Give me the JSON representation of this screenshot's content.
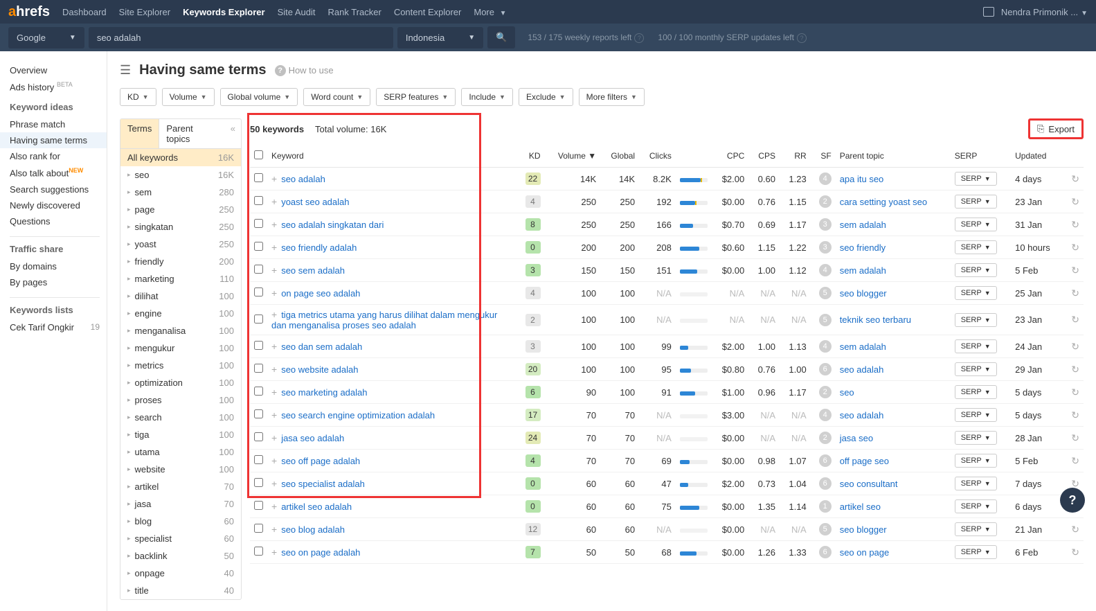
{
  "topnav": {
    "logo_a": "a",
    "logo_rest": "hrefs",
    "items": [
      "Dashboard",
      "Site Explorer",
      "Keywords Explorer",
      "Site Audit",
      "Rank Tracker",
      "Content Explorer",
      "More"
    ],
    "active_index": 2,
    "user": "Nendra Primonik ..."
  },
  "subbar": {
    "engine": "Google",
    "query": "seo adalah",
    "country": "Indonesia",
    "reports_left": "153 / 175 weekly reports left",
    "serp_updates": "100 / 100 monthly SERP updates left"
  },
  "leftnav": {
    "overview": "Overview",
    "ads_history": "Ads history",
    "ads_beta": "BETA",
    "keyword_ideas": "Keyword ideas",
    "ideas": [
      "Phrase match",
      "Having same terms",
      "Also rank for",
      "Also talk about",
      "Search suggestions",
      "Newly discovered",
      "Questions"
    ],
    "also_talk_new": "NEW",
    "active_idea_index": 1,
    "traffic_share": "Traffic share",
    "traffic_items": [
      "By domains",
      "By pages"
    ],
    "keywords_lists": "Keywords lists",
    "list_name": "Cek Tarif Ongkir",
    "list_count": "19"
  },
  "page": {
    "title": "Having same terms",
    "howto": "How to use"
  },
  "filters": [
    "KD",
    "Volume",
    "Global volume",
    "Word count",
    "SERP features",
    "Include",
    "Exclude",
    "More filters"
  ],
  "terms_panel": {
    "tab1": "Terms",
    "tab2": "Parent topics",
    "rows": [
      {
        "t": "All keywords",
        "c": "16K",
        "sel": true,
        "lvl": 0
      },
      {
        "t": "seo",
        "c": "16K",
        "lvl": 1
      },
      {
        "t": "sem",
        "c": "280",
        "lvl": 1
      },
      {
        "t": "page",
        "c": "250",
        "lvl": 1
      },
      {
        "t": "singkatan",
        "c": "250",
        "lvl": 1
      },
      {
        "t": "yoast",
        "c": "250",
        "lvl": 1
      },
      {
        "t": "friendly",
        "c": "200",
        "lvl": 1
      },
      {
        "t": "marketing",
        "c": "110",
        "lvl": 1
      },
      {
        "t": "dilihat",
        "c": "100",
        "lvl": 1
      },
      {
        "t": "engine",
        "c": "100",
        "lvl": 1
      },
      {
        "t": "menganalisa",
        "c": "100",
        "lvl": 1
      },
      {
        "t": "mengukur",
        "c": "100",
        "lvl": 1
      },
      {
        "t": "metrics",
        "c": "100",
        "lvl": 1
      },
      {
        "t": "optimization",
        "c": "100",
        "lvl": 1
      },
      {
        "t": "proses",
        "c": "100",
        "lvl": 1
      },
      {
        "t": "search",
        "c": "100",
        "lvl": 1
      },
      {
        "t": "tiga",
        "c": "100",
        "lvl": 1
      },
      {
        "t": "utama",
        "c": "100",
        "lvl": 1
      },
      {
        "t": "website",
        "c": "100",
        "lvl": 1
      },
      {
        "t": "artikel",
        "c": "70",
        "lvl": 1
      },
      {
        "t": "jasa",
        "c": "70",
        "lvl": 1
      },
      {
        "t": "blog",
        "c": "60",
        "lvl": 1
      },
      {
        "t": "specialist",
        "c": "60",
        "lvl": 1
      },
      {
        "t": "backlink",
        "c": "50",
        "lvl": 1
      },
      {
        "t": "onpage",
        "c": "40",
        "lvl": 1
      },
      {
        "t": "title",
        "c": "40",
        "lvl": 1
      }
    ]
  },
  "table_head": {
    "count": "50 keywords",
    "total_vol": "Total volume: 16K",
    "export": "Export"
  },
  "columns": {
    "keyword": "Keyword",
    "kd": "KD",
    "volume": "Volume",
    "global": "Global",
    "clicks": "Clicks",
    "cpc": "CPC",
    "cps": "CPS",
    "rr": "RR",
    "sf": "SF",
    "parent": "Parent topic",
    "serp": "SERP",
    "updated": "Updated"
  },
  "serp_label": "SERP",
  "rows": [
    {
      "kw": "seo adalah",
      "kd": "22",
      "kdc": "kd-y",
      "vol": "14K",
      "gl": "14K",
      "clk": "8.2K",
      "bar": 75,
      "by": 5,
      "cpc": "$2.00",
      "cps": "0.60",
      "rr": "1.23",
      "sf": "4",
      "pt": "apa itu seo",
      "upd": "4 days"
    },
    {
      "kw": "yoast seo adalah",
      "kd": "4",
      "kdc": "kd-gray",
      "vol": "250",
      "gl": "250",
      "clk": "192",
      "bar": 55,
      "by": 6,
      "cpc": "$0.00",
      "cps": "0.76",
      "rr": "1.15",
      "sf": "2",
      "pt": "cara setting yoast seo",
      "upd": "23 Jan"
    },
    {
      "kw": "seo adalah singkatan dari",
      "kd": "8",
      "kdc": "kd-g0",
      "vol": "250",
      "gl": "250",
      "clk": "166",
      "bar": 48,
      "cpc": "$0.70",
      "cps": "0.69",
      "rr": "1.17",
      "sf": "3",
      "pt": "sem adalah",
      "upd": "31 Jan"
    },
    {
      "kw": "seo friendly adalah",
      "kd": "0",
      "kdc": "kd-g0",
      "vol": "200",
      "gl": "200",
      "clk": "208",
      "bar": 70,
      "cpc": "$0.60",
      "cps": "1.15",
      "rr": "1.22",
      "sf": "3",
      "pt": "seo friendly",
      "upd": "10 hours"
    },
    {
      "kw": "seo sem adalah",
      "kd": "3",
      "kdc": "kd-g0",
      "vol": "150",
      "gl": "150",
      "clk": "151",
      "bar": 62,
      "cpc": "$0.00",
      "cps": "1.00",
      "rr": "1.12",
      "sf": "4",
      "pt": "sem adalah",
      "upd": "5 Feb"
    },
    {
      "kw": "on page seo adalah",
      "kd": "4",
      "kdc": "kd-gray",
      "vol": "100",
      "gl": "100",
      "clk": "N/A",
      "bar": 0,
      "cpc": "N/A",
      "cps": "N/A",
      "rr": "N/A",
      "sf": "5",
      "pt": "seo blogger",
      "upd": "25 Jan"
    },
    {
      "kw": "tiga metrics utama yang harus dilihat dalam mengukur dan menganalisa proses seo adalah",
      "kd": "2",
      "kdc": "kd-gray",
      "vol": "100",
      "gl": "100",
      "clk": "N/A",
      "bar": 0,
      "cpc": "N/A",
      "cps": "N/A",
      "rr": "N/A",
      "sf": "5",
      "pt": "teknik seo terbaru",
      "upd": "23 Jan"
    },
    {
      "kw": "seo dan sem adalah",
      "kd": "3",
      "kdc": "kd-gray",
      "vol": "100",
      "gl": "100",
      "clk": "99",
      "bar": 30,
      "cpc": "$2.00",
      "cps": "1.00",
      "rr": "1.13",
      "sf": "4",
      "pt": "sem adalah",
      "upd": "24 Jan"
    },
    {
      "kw": "seo website adalah",
      "kd": "20",
      "kdc": "kd-lg",
      "vol": "100",
      "gl": "100",
      "clk": "95",
      "bar": 40,
      "cpc": "$0.80",
      "cps": "0.76",
      "rr": "1.00",
      "sf": "6",
      "pt": "seo adalah",
      "upd": "29 Jan"
    },
    {
      "kw": "seo marketing adalah",
      "kd": "6",
      "kdc": "kd-g0",
      "vol": "90",
      "gl": "100",
      "clk": "91",
      "bar": 55,
      "cpc": "$1.00",
      "cps": "0.96",
      "rr": "1.17",
      "sf": "2",
      "pt": "seo",
      "upd": "5 days"
    },
    {
      "kw": "seo search engine optimization adalah",
      "kd": "17",
      "kdc": "kd-lg",
      "vol": "70",
      "gl": "70",
      "clk": "N/A",
      "bar": 0,
      "cpc": "$3.00",
      "cps": "N/A",
      "rr": "N/A",
      "sf": "4",
      "pt": "seo adalah",
      "upd": "5 days"
    },
    {
      "kw": "jasa seo adalah",
      "kd": "24",
      "kdc": "kd-y",
      "vol": "70",
      "gl": "70",
      "clk": "N/A",
      "bar": 0,
      "cpc": "$0.00",
      "cps": "N/A",
      "rr": "N/A",
      "sf": "2",
      "pt": "jasa seo",
      "upd": "28 Jan"
    },
    {
      "kw": "seo off page adalah",
      "kd": "4",
      "kdc": "kd-g0",
      "vol": "70",
      "gl": "70",
      "clk": "69",
      "bar": 35,
      "cpc": "$0.00",
      "cps": "0.98",
      "rr": "1.07",
      "sf": "6",
      "pt": "off page seo",
      "upd": "5 Feb"
    },
    {
      "kw": "seo specialist adalah",
      "kd": "0",
      "kdc": "kd-g0",
      "vol": "60",
      "gl": "60",
      "clk": "47",
      "bar": 30,
      "cpc": "$2.00",
      "cps": "0.73",
      "rr": "1.04",
      "sf": "6",
      "pt": "seo consultant",
      "upd": "7 days"
    },
    {
      "kw": "artikel seo adalah",
      "kd": "0",
      "kdc": "kd-g0",
      "vol": "60",
      "gl": "60",
      "clk": "75",
      "bar": 70,
      "cpc": "$0.00",
      "cps": "1.35",
      "rr": "1.14",
      "sf": "1",
      "pt": "artikel seo",
      "upd": "6 days"
    },
    {
      "kw": "seo blog adalah",
      "kd": "12",
      "kdc": "kd-gray",
      "vol": "60",
      "gl": "60",
      "clk": "N/A",
      "bar": 0,
      "cpc": "$0.00",
      "cps": "N/A",
      "rr": "N/A",
      "sf": "5",
      "pt": "seo blogger",
      "upd": "21 Jan"
    },
    {
      "kw": "seo on page adalah",
      "kd": "7",
      "kdc": "kd-g0",
      "vol": "50",
      "gl": "50",
      "clk": "68",
      "bar": 60,
      "cpc": "$0.00",
      "cps": "1.26",
      "rr": "1.33",
      "sf": "6",
      "pt": "seo on page",
      "upd": "6 Feb"
    }
  ]
}
